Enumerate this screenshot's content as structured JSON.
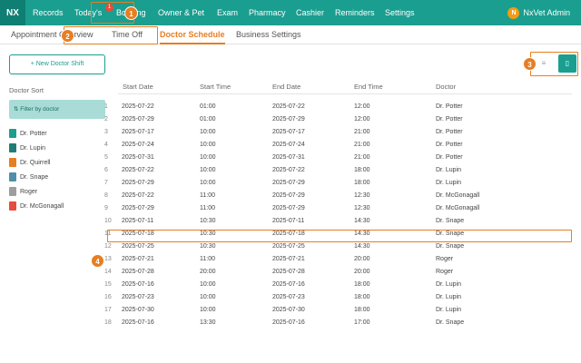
{
  "app": {
    "logo": "NX"
  },
  "nav": {
    "items": [
      "Records",
      "Today's",
      "Booking",
      "Owner & Pet",
      "Exam",
      "Pharmacy",
      "Cashier",
      "Reminders",
      "Settings"
    ],
    "badge": "1",
    "user": {
      "initial": "N",
      "name": "NxVet Admin"
    }
  },
  "subtabs": [
    "Appointment Overview",
    "Time Off",
    "Doctor Schedule",
    "Business Settings"
  ],
  "annotations": [
    "1",
    "2",
    "3",
    "4"
  ],
  "sidebar": {
    "new_shift": "+ New Doctor Shift",
    "sort_label": "Doctor Sort",
    "filter_label": "⇅ Filter by doctor",
    "doctors": [
      {
        "name": "Dr. Potter",
        "color": "#1a9e8f"
      },
      {
        "name": "Dr. Lupin",
        "color": "#1f7d74"
      },
      {
        "name": "Dr. Quirrell",
        "color": "#e67e22"
      },
      {
        "name": "Dr. Snape",
        "color": "#4f8fa8"
      },
      {
        "name": "Roger",
        "color": "#9e9e9e"
      },
      {
        "name": "Dr. McGonagall",
        "color": "#e74c3c"
      }
    ]
  },
  "view_icons": {
    "list": "≡",
    "calendar": "▯"
  },
  "table": {
    "columns": [
      "Start Date",
      "Start Time",
      "End Date",
      "End Time",
      "Doctor"
    ],
    "rows": [
      [
        "1",
        "2025-07-22",
        "01:00",
        "2025-07-22",
        "12:00",
        "Dr. Potter"
      ],
      [
        "2",
        "2025-07-29",
        "01:00",
        "2025-07-29",
        "12:00",
        "Dr. Potter"
      ],
      [
        "3",
        "2025-07-17",
        "10:00",
        "2025-07-17",
        "21:00",
        "Dr. Potter"
      ],
      [
        "4",
        "2025-07-24",
        "10:00",
        "2025-07-24",
        "21:00",
        "Dr. Potter"
      ],
      [
        "5",
        "2025-07-31",
        "10:00",
        "2025-07-31",
        "21:00",
        "Dr. Potter"
      ],
      [
        "6",
        "2025-07-22",
        "10:00",
        "2025-07-22",
        "18:00",
        "Dr. Lupin"
      ],
      [
        "7",
        "2025-07-29",
        "10:00",
        "2025-07-29",
        "18:00",
        "Dr. Lupin"
      ],
      [
        "8",
        "2025-07-22",
        "11:00",
        "2025-07-29",
        "12:30",
        "Dr. McGonagall"
      ],
      [
        "9",
        "2025-07-29",
        "11:00",
        "2025-07-29",
        "12:30",
        "Dr. McGonagall"
      ],
      [
        "10",
        "2025-07-11",
        "10:30",
        "2025-07-11",
        "14:30",
        "Dr. Snape"
      ],
      [
        "11",
        "2025-07-18",
        "10:30",
        "2025-07-18",
        "14:30",
        "Dr. Snape"
      ],
      [
        "12",
        "2025-07-25",
        "10:30",
        "2025-07-25",
        "14:30",
        "Dr. Snape"
      ],
      [
        "13",
        "2025-07-21",
        "11:00",
        "2025-07-21",
        "20:00",
        "Roger"
      ],
      [
        "14",
        "2025-07-28",
        "20:00",
        "2025-07-28",
        "20:00",
        "Roger"
      ],
      [
        "15",
        "2025-07-16",
        "10:00",
        "2025-07-16",
        "18:00",
        "Dr. Lupin"
      ],
      [
        "16",
        "2025-07-23",
        "10:00",
        "2025-07-23",
        "18:00",
        "Dr. Lupin"
      ],
      [
        "17",
        "2025-07-30",
        "10:00",
        "2025-07-30",
        "18:00",
        "Dr. Lupin"
      ],
      [
        "18",
        "2025-07-16",
        "13:30",
        "2025-07-16",
        "17:00",
        "Dr. Snape"
      ]
    ]
  }
}
